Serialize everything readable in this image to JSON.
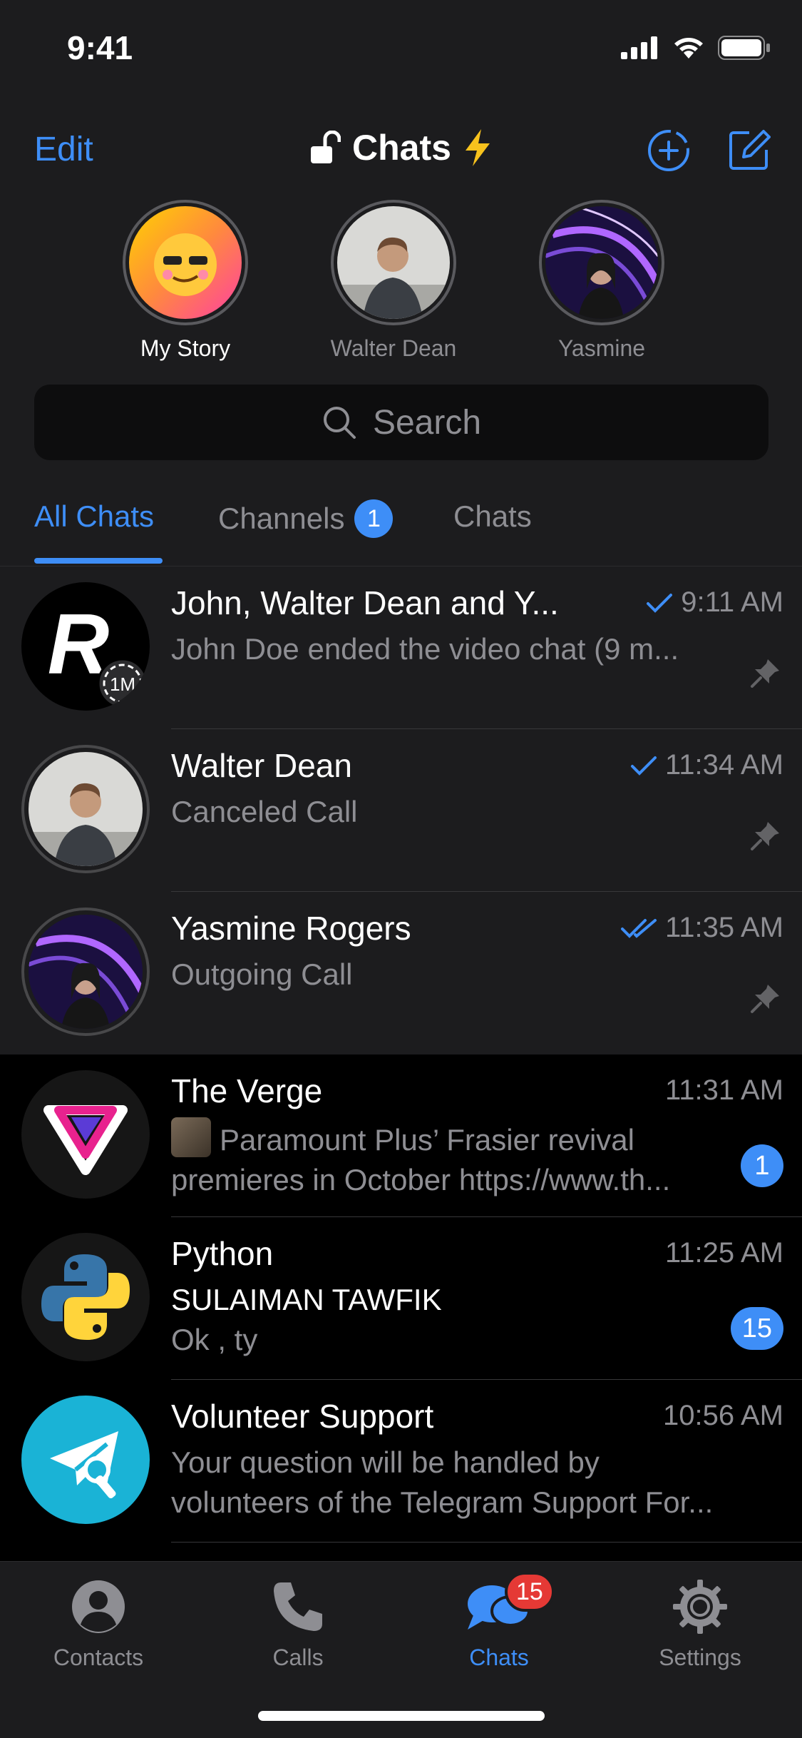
{
  "status": {
    "time": "9:41"
  },
  "header": {
    "edit_label": "Edit",
    "title": "Chats"
  },
  "stories": [
    {
      "label": "My Story"
    },
    {
      "label": "Walter Dean"
    },
    {
      "label": "Yasmine"
    }
  ],
  "search": {
    "placeholder": "Search"
  },
  "tabs": [
    {
      "label": "All Chats"
    },
    {
      "label": "Channels",
      "badge": "1"
    },
    {
      "label": "Chats"
    }
  ],
  "chats": [
    {
      "name": "John, Walter Dean and Y...",
      "time": "9:11 AM",
      "message": "John Doe ended the video chat (9 m...",
      "avatar_letter": "R",
      "timer": "1M"
    },
    {
      "name": "Walter Dean",
      "time": "11:34 AM",
      "message": "Canceled Call"
    },
    {
      "name": "Yasmine Rogers",
      "time": "11:35 AM",
      "message": "Outgoing Call"
    },
    {
      "name": "The Verge",
      "time": "11:31 AM",
      "message": "Paramount Plus’ Frasier revival premieres in October https://www.th...",
      "unread": "1"
    },
    {
      "name": "Python",
      "time": "11:25 AM",
      "sender": "SULAIMAN TAWFIK",
      "message": "Ok , ty",
      "unread": "15"
    },
    {
      "name": "Volunteer Support",
      "time": "10:56 AM",
      "message": "Your question will be handled by volunteers of the Telegram Support For..."
    }
  ],
  "tab_bar": [
    {
      "label": "Contacts"
    },
    {
      "label": "Calls"
    },
    {
      "label": "Chats",
      "badge": "15"
    },
    {
      "label": "Settings"
    }
  ],
  "colors": {
    "accent": "#3e8ef7",
    "badge_red": "#e53935",
    "background": "#000000",
    "panel": "#1c1c1e"
  }
}
